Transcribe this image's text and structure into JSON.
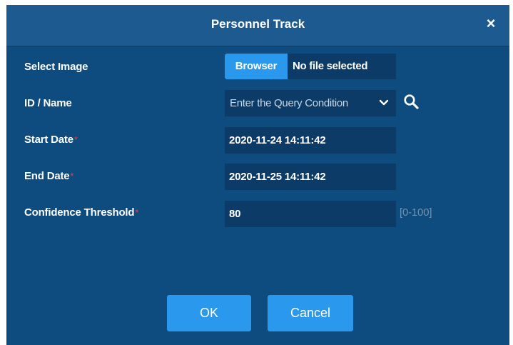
{
  "dialog": {
    "title": "Personnel Track",
    "close_glyph": "×"
  },
  "form": {
    "select_image": {
      "label": "Select Image",
      "browse_button": "Browser",
      "file_status": "No file selected"
    },
    "id_name": {
      "label": "ID / Name",
      "placeholder": "Enter the Query Condition",
      "icon": "search-icon"
    },
    "start_date": {
      "label": "Start Date",
      "required_mark": "*",
      "value": "2020-11-24 14:11:42"
    },
    "end_date": {
      "label": "End Date",
      "required_mark": "*",
      "value": "2020-11-25 14:11:42"
    },
    "confidence": {
      "label": "Confidence Threshold",
      "required_mark": "*",
      "value": "80",
      "range_hint": "[0-100]"
    }
  },
  "buttons": {
    "ok": "OK",
    "cancel": "Cancel"
  },
  "colors": {
    "dialog_bg": "#0e4b7f",
    "titlebar_bg": "#1c5a90",
    "field_bg": "#0b3b66",
    "accent": "#2a98ec",
    "required": "#e0414a"
  }
}
